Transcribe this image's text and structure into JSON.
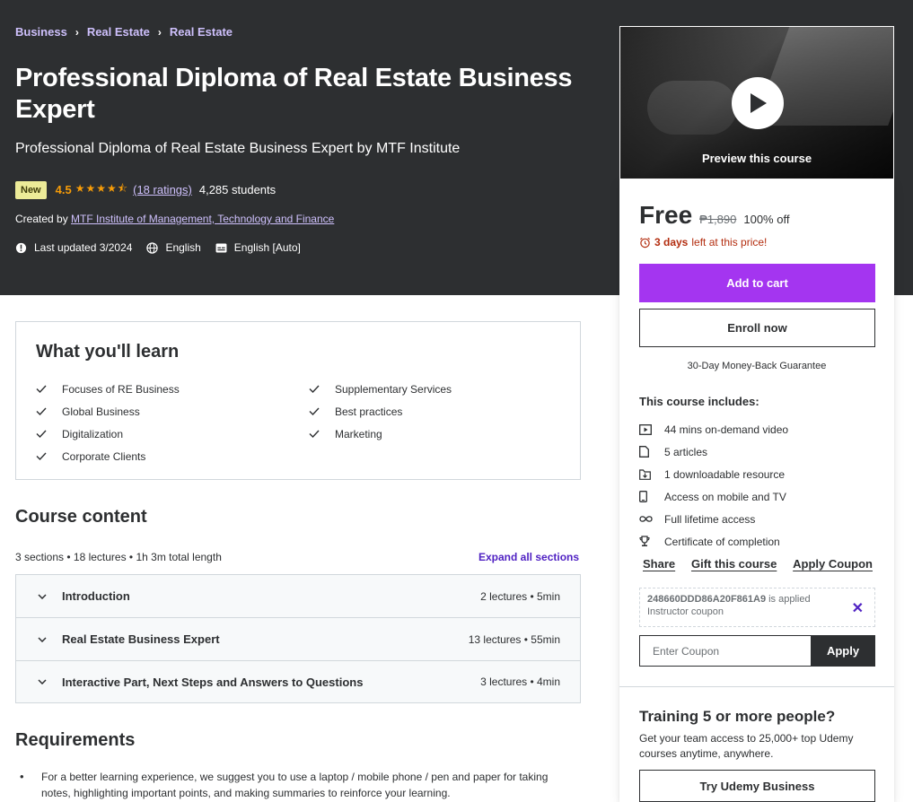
{
  "breadcrumb": [
    "Business",
    "Real Estate",
    "Real Estate"
  ],
  "course": {
    "title": "Professional Diploma of Real Estate Business Expert",
    "subtitle": "Professional Diploma of Real Estate Business Expert by MTF Institute",
    "badge": "New",
    "rating": "4.5",
    "ratings_count": "(18 ratings)",
    "students": "4,285 students",
    "created_by_label": "Created by",
    "instructor": "MTF Institute of Management, Technology and Finance",
    "last_updated": "Last updated 3/2024",
    "language": "English",
    "captions": "English [Auto]"
  },
  "preview": {
    "label": "Preview this course"
  },
  "purchase": {
    "price": "Free",
    "original_price": "₱1,890",
    "discount": "100% off",
    "timer_bold": "3 days",
    "timer_rest": "left at this price!",
    "add_to_cart": "Add to cart",
    "enroll_now": "Enroll now",
    "guarantee": "30-Day Money-Back Guarantee",
    "includes_title": "This course includes:",
    "includes": [
      {
        "icon": "video-icon",
        "text": "44 mins on-demand video"
      },
      {
        "icon": "article-icon",
        "text": "5 articles"
      },
      {
        "icon": "download-icon",
        "text": "1 downloadable resource"
      },
      {
        "icon": "mobile-icon",
        "text": "Access on mobile and TV"
      },
      {
        "icon": "infinity-icon",
        "text": "Full lifetime access"
      },
      {
        "icon": "trophy-icon",
        "text": "Certificate of completion"
      }
    ],
    "share": "Share",
    "gift": "Gift this course",
    "apply_coupon": "Apply Coupon",
    "coupon_code": "248660DDD86A20F861A9",
    "coupon_applied": "is applied",
    "coupon_sub": "Instructor coupon",
    "coupon_placeholder": "Enter Coupon",
    "coupon_apply_btn": "Apply"
  },
  "business": {
    "title": "Training 5 or more people?",
    "text": "Get your team access to 25,000+ top Udemy courses anytime, anywhere.",
    "button": "Try Udemy Business"
  },
  "learn": {
    "title": "What you'll learn",
    "col1": [
      "Focuses of RE Business",
      "Global Business",
      "Digitalization",
      "Corporate Clients"
    ],
    "col2": [
      "Supplementary Services",
      "Best practices",
      "Marketing"
    ]
  },
  "content": {
    "title": "Course content",
    "meta": "3 sections • 18 lectures • 1h 3m total length",
    "expand": "Expand all sections",
    "sections": [
      {
        "title": "Introduction",
        "info": "2 lectures • 5min"
      },
      {
        "title": "Real Estate Business Expert",
        "info": "13 lectures • 55min"
      },
      {
        "title": "Interactive Part, Next Steps and Answers to Questions",
        "info": "3 lectures • 4min"
      }
    ]
  },
  "requirements": {
    "title": "Requirements",
    "items": [
      "For a better learning experience, we suggest you to use a laptop / mobile phone / pen and paper for taking notes, highlighting important points, and making summaries to reinforce your learning."
    ]
  }
}
